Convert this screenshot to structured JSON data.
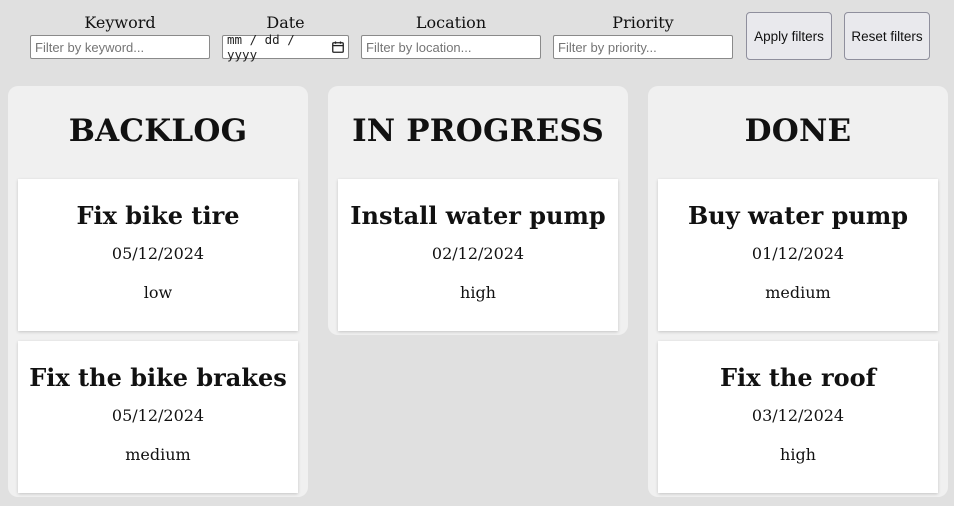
{
  "filters": {
    "keyword": {
      "label": "Keyword",
      "placeholder": "Filter by keyword..."
    },
    "date": {
      "label": "Date",
      "placeholder": "mm / dd / yyyy"
    },
    "location": {
      "label": "Location",
      "placeholder": "Filter by location..."
    },
    "priority": {
      "label": "Priority",
      "placeholder": "Filter by priority..."
    },
    "apply_label": "Apply filters",
    "reset_label": "Reset filters"
  },
  "columns": [
    {
      "title": "BACKLOG",
      "cards": [
        {
          "title": "Fix bike tire",
          "date": "05/12/2024",
          "priority": "low"
        },
        {
          "title": "Fix the bike brakes",
          "date": "05/12/2024",
          "priority": "medium"
        }
      ]
    },
    {
      "title": "IN PROGRESS",
      "cards": [
        {
          "title": "Install water pump",
          "date": "02/12/2024",
          "priority": "high"
        }
      ]
    },
    {
      "title": "DONE",
      "cards": [
        {
          "title": "Buy water pump",
          "date": "01/12/2024",
          "priority": "medium"
        },
        {
          "title": "Fix the roof",
          "date": "03/12/2024",
          "priority": "high"
        }
      ]
    }
  ]
}
